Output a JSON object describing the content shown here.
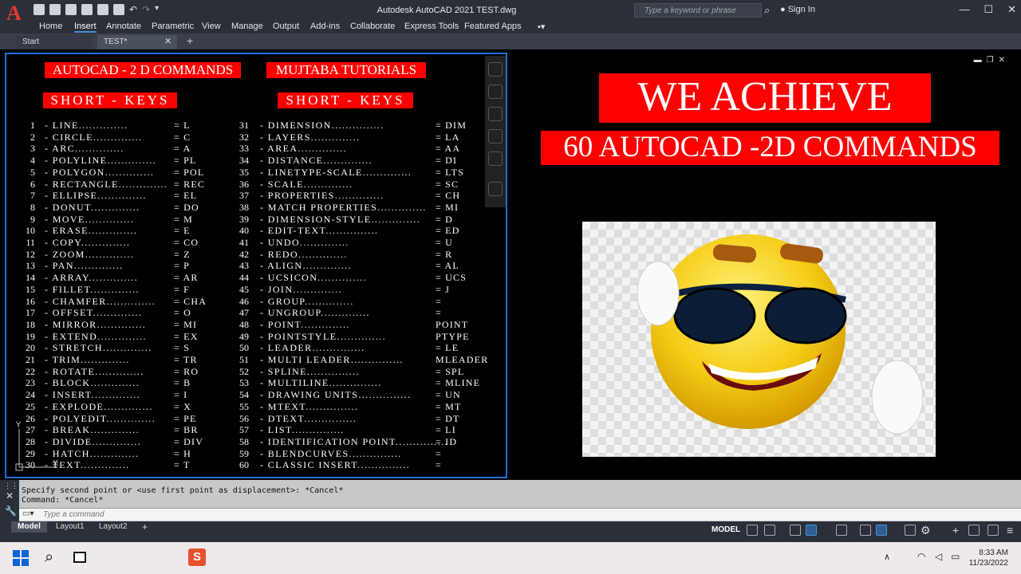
{
  "window": {
    "app_title": "Autodesk AutoCAD 2021    TEST.dwg",
    "logo": "A",
    "search_placeholder": "Type a keyword or phrase",
    "signin": "Sign In"
  },
  "ribbon": {
    "tabs": [
      "Home",
      "Insert",
      "Annotate",
      "Parametric",
      "View",
      "Manage",
      "Output",
      "Add-ins",
      "Collaborate",
      "Express Tools",
      "Featured Apps"
    ],
    "active": "Insert"
  },
  "doc_tabs": {
    "start": "Start",
    "current": "TEST*",
    "close": "✕",
    "add": "+"
  },
  "left_panel": {
    "header1": "AUTOCAD - 2 D COMMANDS",
    "header2": "MUJTABA TUTORIALS",
    "sub1": "SHORT - KEYS",
    "sub2": "SHORT - KEYS",
    "col1": [
      {
        "n": "1",
        "cmd": "- LINE..............",
        "key": "= L"
      },
      {
        "n": "2",
        "cmd": "- CIRCLE..............",
        "key": "= C"
      },
      {
        "n": "3",
        "cmd": "- ARC..............",
        "key": "= A"
      },
      {
        "n": "4",
        "cmd": "- POLYLINE..............",
        "key": "= PL"
      },
      {
        "n": "5",
        "cmd": "- POLYGON..............",
        "key": "= POL"
      },
      {
        "n": "6",
        "cmd": "- RECTANGLE..............",
        "key": "= REC"
      },
      {
        "n": "7",
        "cmd": "- ELLIPSE..............",
        "key": "= EL"
      },
      {
        "n": "8",
        "cmd": "- DONUT..............",
        "key": "= DO"
      },
      {
        "n": "9",
        "cmd": "- MOVE..............",
        "key": "= M"
      },
      {
        "n": "10",
        "cmd": "- ERASE..............",
        "key": "= E"
      },
      {
        "n": "11",
        "cmd": "- COPY..............",
        "key": "= CO"
      },
      {
        "n": "12",
        "cmd": "- ZOOM..............",
        "key": "= Z"
      },
      {
        "n": "13",
        "cmd": "- PAN..............",
        "key": "= P"
      },
      {
        "n": "14",
        "cmd": "- ARRAY..............",
        "key": "= AR"
      },
      {
        "n": "15",
        "cmd": "- FILLET..............",
        "key": "= F"
      },
      {
        "n": "16",
        "cmd": "- CHAMFER..............",
        "key": "= CHA"
      },
      {
        "n": "17",
        "cmd": "- OFFSET..............",
        "key": "= O"
      },
      {
        "n": "18",
        "cmd": "- MIRROR..............",
        "key": "= MI"
      },
      {
        "n": "19",
        "cmd": "- EXTEND..............",
        "key": "= EX"
      },
      {
        "n": "20",
        "cmd": "- STRETCH..............",
        "key": "= S"
      },
      {
        "n": "21",
        "cmd": "- TRIM..............",
        "key": "= TR"
      },
      {
        "n": "22",
        "cmd": "- ROTATE..............",
        "key": "= RO"
      },
      {
        "n": "23",
        "cmd": "- BLOCK..............",
        "key": "= B"
      },
      {
        "n": "24",
        "cmd": "- INSERT..............",
        "key": "= I"
      },
      {
        "n": "25",
        "cmd": "- EXPLODE..............",
        "key": "= X"
      },
      {
        "n": "26",
        "cmd": "- POLYEDIT..............",
        "key": "= PE"
      },
      {
        "n": "27",
        "cmd": "- BREAK..............",
        "key": "= BR"
      },
      {
        "n": "28",
        "cmd": "- DIVIDE..............",
        "key": "= DIV"
      },
      {
        "n": "29",
        "cmd": "- HATCH..............",
        "key": "= H"
      },
      {
        "n": "30",
        "cmd": "- TEXT..............",
        "key": "= T"
      }
    ],
    "col2": [
      {
        "n": "31",
        "cmd": "- DIMENSION...............",
        "key": "= DIM"
      },
      {
        "n": "32",
        "cmd": "- LAYERS..............",
        "key": "= LA"
      },
      {
        "n": "33",
        "cmd": "- AREA..............",
        "key": "= AA"
      },
      {
        "n": "34",
        "cmd": "- DISTANCE..............",
        "key": "= DI"
      },
      {
        "n": "35",
        "cmd": "- LINETYPE-SCALE..............",
        "key": "= LTS"
      },
      {
        "n": "36",
        "cmd": "- SCALE..............",
        "key": "= SC"
      },
      {
        "n": "37",
        "cmd": "- PROPERTIES..............",
        "key": "= CH"
      },
      {
        "n": "38",
        "cmd": "- MATCH PROPERTIES..............",
        "key": "= MI"
      },
      {
        "n": "39",
        "cmd": "- DIMENSION-STYLE..............",
        "key": "= D"
      },
      {
        "n": "40",
        "cmd": "- EDIT-TEXT...............",
        "key": "= ED"
      },
      {
        "n": "41",
        "cmd": "- UNDO..............",
        "key": "= U"
      },
      {
        "n": "42",
        "cmd": "- REDO..............",
        "key": "= R"
      },
      {
        "n": "43",
        "cmd": "- ALIGN..............",
        "key": "= AL"
      },
      {
        "n": "44",
        "cmd": "- UCSICON..............",
        "key": "= UCS"
      },
      {
        "n": "45",
        "cmd": "- JOIN..............",
        "key": "= J"
      },
      {
        "n": "46",
        "cmd": "- GROUP..............",
        "key": "="
      },
      {
        "n": "47",
        "cmd": "- UNGROUP..............",
        "key": "="
      },
      {
        "n": "48",
        "cmd": "- POINT..............",
        "key": "POINT"
      },
      {
        "n": "49",
        "cmd": "- POINTSTYLE..............",
        "key": "PTYPE"
      },
      {
        "n": "50",
        "cmd": "- LEADER...............",
        "key": "= LE"
      },
      {
        "n": "51",
        "cmd": "- MULTI LEADER...............",
        "key": "MLEADER"
      },
      {
        "n": "52",
        "cmd": "- SPLINE...............",
        "key": "= SPL"
      },
      {
        "n": "53",
        "cmd": "- MULTILINE...............",
        "key": "= MLINE"
      },
      {
        "n": "54",
        "cmd": "- DRAWING UNITS...............",
        "key": "= UN"
      },
      {
        "n": "55",
        "cmd": "- MTEXT...............",
        "key": "= MT"
      },
      {
        "n": "56",
        "cmd": "- DTEXT...............",
        "key": "= DT"
      },
      {
        "n": "57",
        "cmd": "- LIST...............",
        "key": "= LI"
      },
      {
        "n": "58",
        "cmd": "- IDENTIFICATION POINT...............",
        "key": "= ID"
      },
      {
        "n": "59",
        "cmd": "- BLENDCURVES...............",
        "key": "="
      },
      {
        "n": "60",
        "cmd": "- CLASSIC INSERT...............",
        "key": "="
      }
    ]
  },
  "right_panel": {
    "banner1": "WE ACHIEVE",
    "banner2": "60 AUTOCAD -2D COMMANDS",
    "image_icon": "smiley-sunglasses-thumbs-up"
  },
  "command_line": {
    "history1": "Specify second point or <use first point as displacement>: *Cancel*",
    "history2": "Command: *Cancel*",
    "placeholder": "Type a command"
  },
  "layout_tabs": [
    "Model",
    "Layout1",
    "Layout2"
  ],
  "status": {
    "model": "MODEL"
  },
  "taskbar": {
    "time": "8:33 AM",
    "date": "11/23/2022"
  },
  "colors": {
    "banner_red": "#ff0000",
    "viewport_border": "#1f6fd6",
    "accent": "#4a90d9"
  }
}
